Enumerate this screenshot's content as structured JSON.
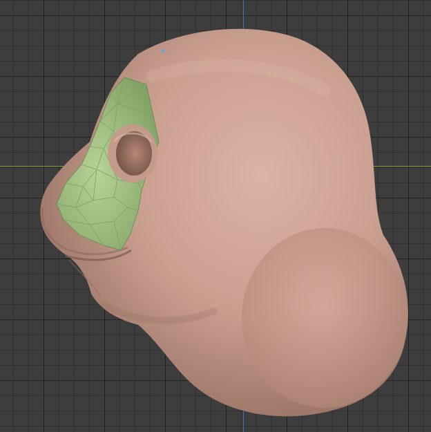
{
  "viewport": {
    "background_color": "#3d3d3d",
    "grid_color": "#2a2a2a",
    "x_axis_color": "#7a9b2e",
    "y_axis_color": "#3e6db8"
  },
  "model": {
    "skin_color": "#c49a8b",
    "highlight_color": "#d9b2a3",
    "shadow_color": "#8e6a5d",
    "mask_color": "#9ec07f",
    "mask_edge_color": "#6f8f57"
  }
}
